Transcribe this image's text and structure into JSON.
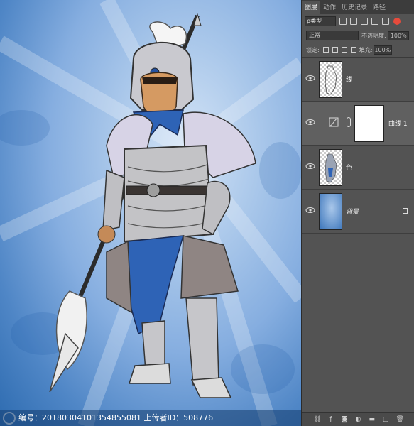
{
  "canvas": {
    "watermark_text": "编号：20180304101354855081 上传者ID：508776"
  },
  "panel": {
    "tabs": [
      {
        "label": "图层",
        "active": true
      },
      {
        "label": "动作",
        "active": false
      },
      {
        "label": "历史记录",
        "active": false
      },
      {
        "label": "路径",
        "active": false
      }
    ],
    "filter_label": "ρ类型",
    "blend_mode": "正常",
    "opacity_label": "不透明度:",
    "opacity_value": "100%",
    "lock_label": "锁定:",
    "fill_label": "填充:",
    "fill_value": "100%"
  },
  "layers": [
    {
      "name": "线",
      "type": "pixel",
      "selected": false,
      "visible": true
    },
    {
      "name": "曲线 1",
      "type": "adjustment",
      "selected": true,
      "visible": true
    },
    {
      "name": "色",
      "type": "pixel",
      "selected": false,
      "visible": true
    },
    {
      "name": "背景",
      "type": "background",
      "selected": false,
      "visible": true,
      "locked": true
    }
  ],
  "bottom_icons": [
    "link-icon",
    "fx-icon",
    "mask-icon",
    "adjustment-icon",
    "folder-icon",
    "new-layer-icon",
    "trash-icon"
  ]
}
